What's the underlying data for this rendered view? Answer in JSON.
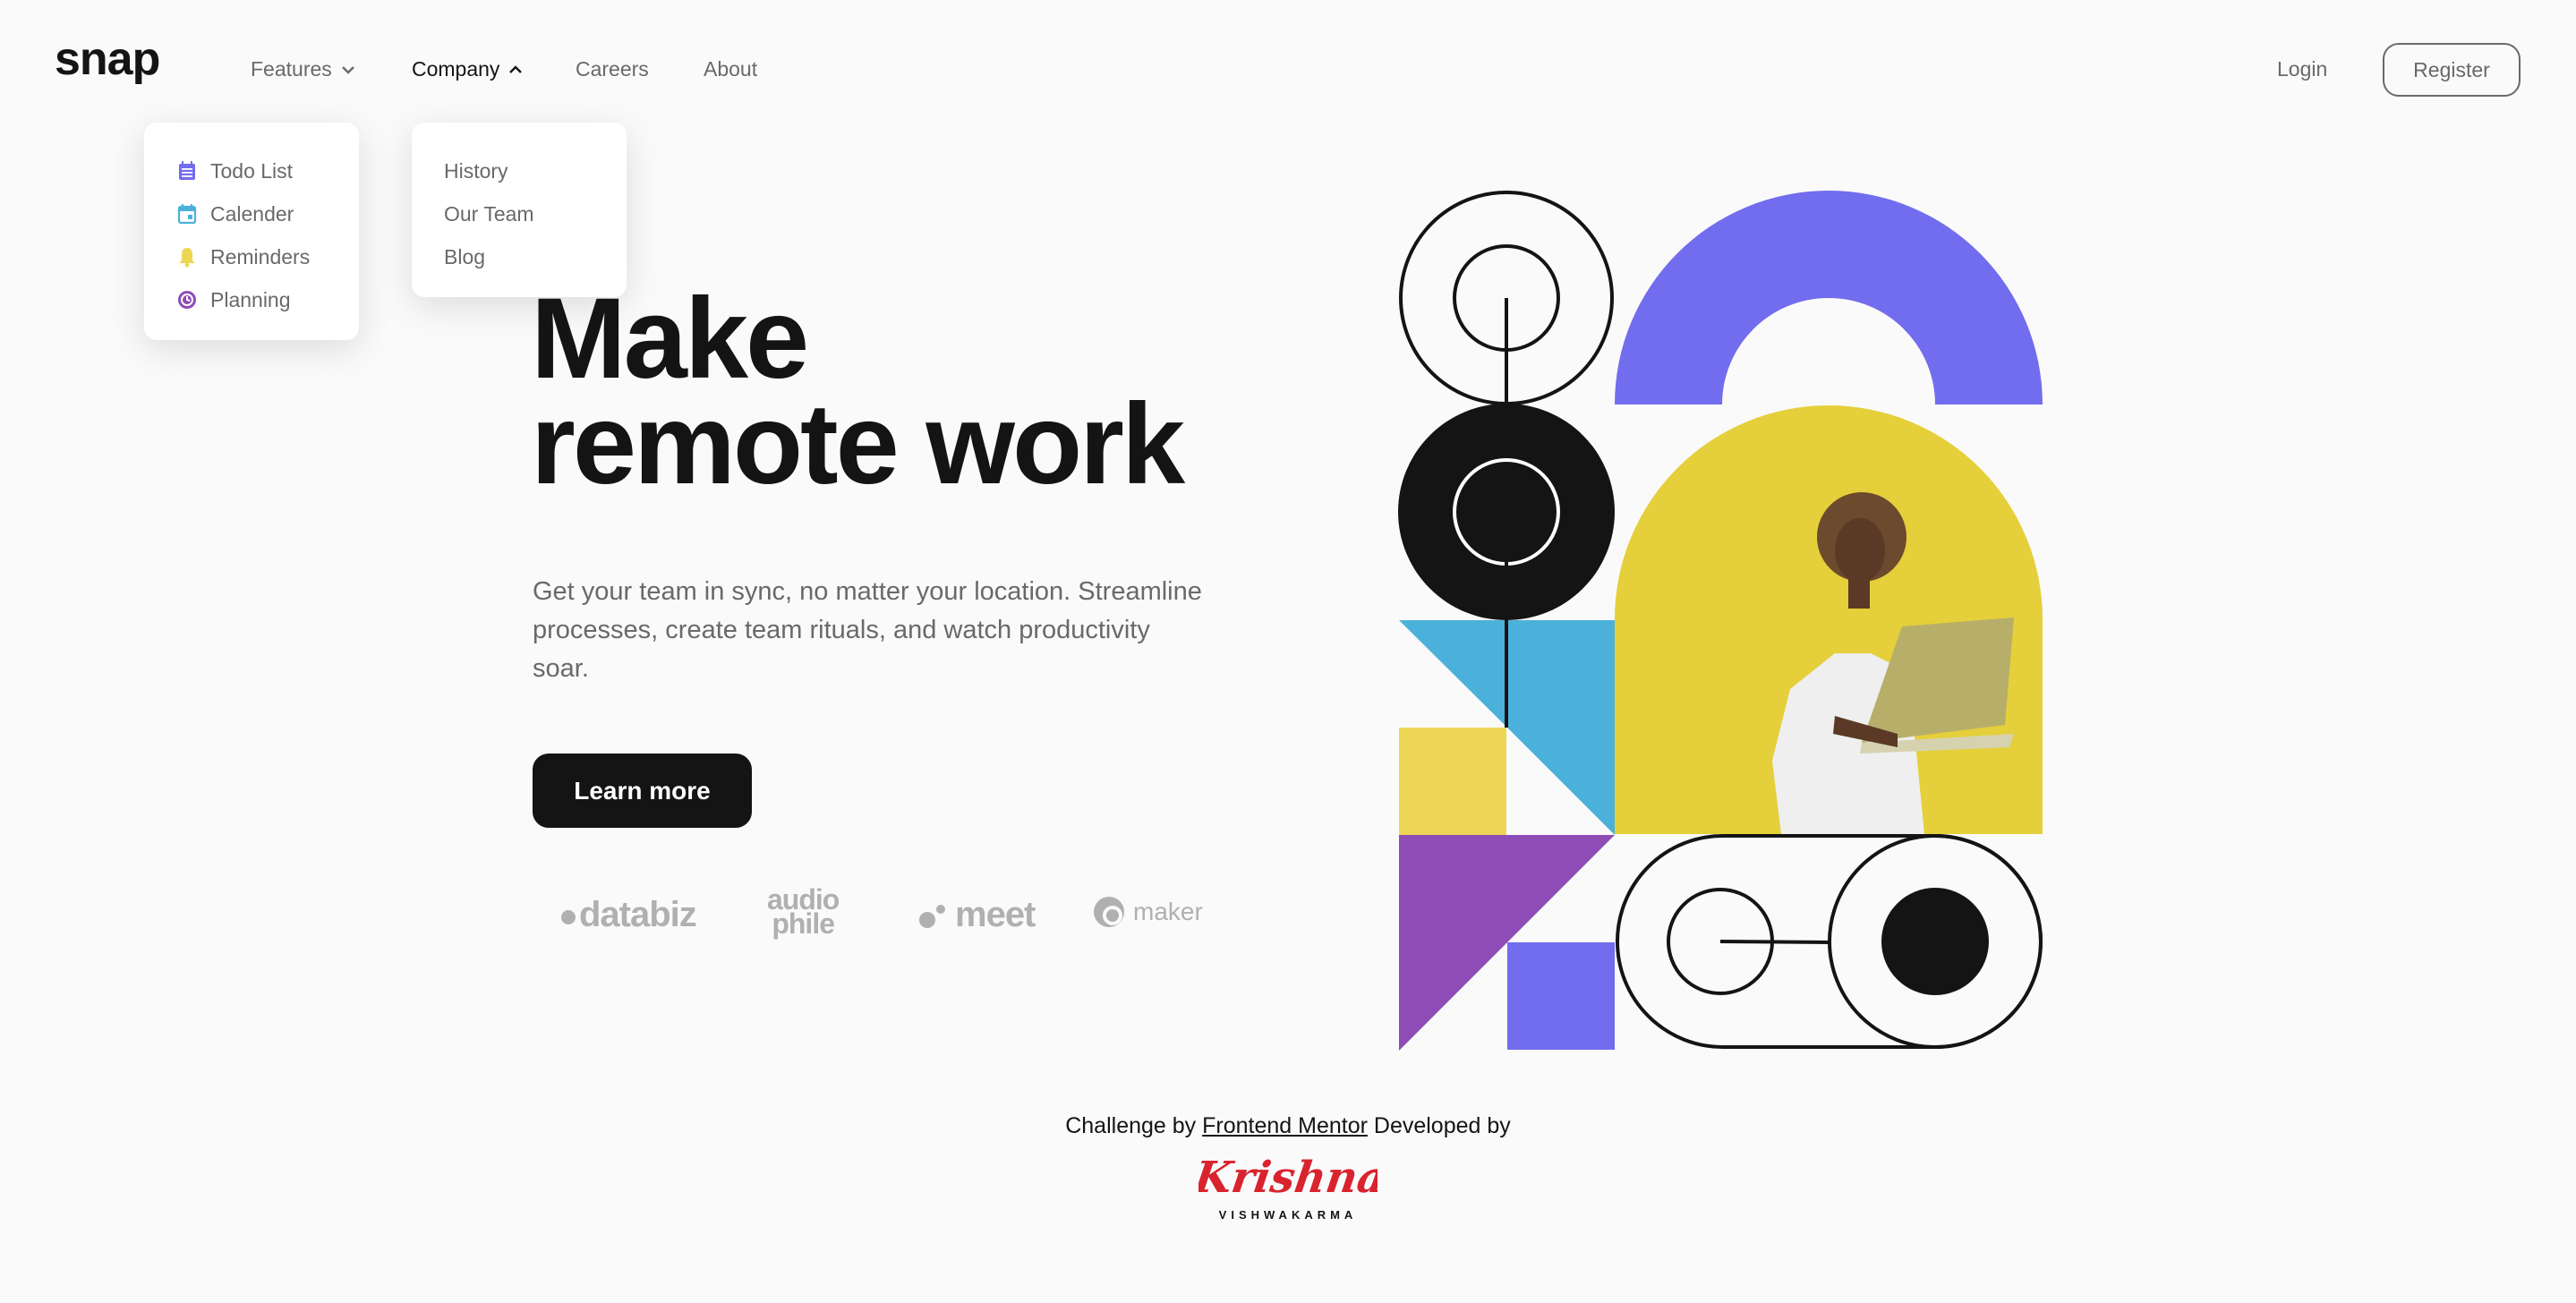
{
  "brand": {
    "logo": "snap"
  },
  "nav": {
    "features": "Features",
    "company": "Company",
    "careers": "Careers",
    "about": "About",
    "login": "Login",
    "register": "Register"
  },
  "features_menu": [
    {
      "label": "Todo List",
      "icon": "calendar-list-icon",
      "color": "#726cee"
    },
    {
      "label": "Calender",
      "icon": "calendar-icon",
      "color": "#4bb1da"
    },
    {
      "label": "Reminders",
      "icon": "bell-icon",
      "color": "#edd556"
    },
    {
      "label": "Planning",
      "icon": "clock-icon",
      "color": "#8e4cb6"
    }
  ],
  "company_menu": [
    {
      "label": "History"
    },
    {
      "label": "Our Team"
    },
    {
      "label": "Blog"
    }
  ],
  "hero": {
    "title_line1": "Make",
    "title_line2": "remote work",
    "description": "Get your team in sync, no matter your location. Streamline processes, create team rituals, and watch productivity soar.",
    "cta": "Learn more"
  },
  "clients": {
    "databiz": "databiz",
    "audiophile_top": "audio",
    "audiophile_bottom": "phile",
    "meet": "meet",
    "maker": "maker"
  },
  "footer": {
    "prefix": "Challenge by",
    "link": "Frontend Mentor",
    "suffix": "Developed by",
    "signature_name": "Krishna",
    "signature_sub": "VISHWAKARMA"
  },
  "colors": {
    "dark": "#141414",
    "gray": "#696969",
    "purple": "#726cee",
    "blue": "#4bb1da",
    "yellow": "#edd556",
    "violet": "#8e4cb6",
    "signature_red": "#d9232e"
  }
}
